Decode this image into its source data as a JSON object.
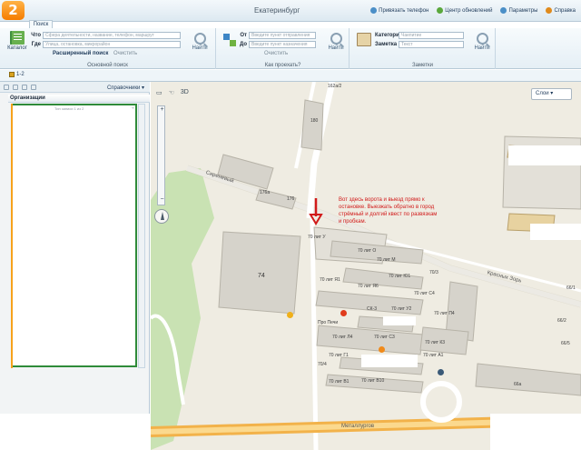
{
  "app": {
    "logo_text": "2",
    "window_title": "Екатеринбург",
    "top_links": [
      "Привязать телефон",
      "Центр обновлений",
      "Параметры",
      "Справка"
    ],
    "tab": "Поиск"
  },
  "ribbon": {
    "catalog_label": "Каталог",
    "what_label": "Что",
    "what_placeholder": "Сфера деятельности, название, телефон, маршрут",
    "where_label": "Где",
    "where_placeholder": "Улица, остановка, микрорайон",
    "advanced_search": "Расширенный поиск",
    "clear": "Очистить",
    "find": "Найти",
    "group_basic": "Основной поиск",
    "from_label": "От",
    "from_placeholder": "Введите пункт отправления",
    "to_label": "До",
    "to_placeholder": "Введите пункт назначения",
    "group_route": "Как проехать?",
    "category_label": "Категория",
    "category_value": "Чаепитие",
    "note_label": "Заметка",
    "note_placeholder": "Текст",
    "group_notes": "Заметки"
  },
  "subbar": {
    "tab_label": "1-2"
  },
  "left_panel": {
    "dropdown": "Справочники",
    "header": "Организации",
    "row_text": "Тип записи 1 из 2",
    "pager": "⇢"
  },
  "map": {
    "mode_3d": "3D",
    "layers": "Слои",
    "annotation": "Вот здесь ворота и выезд прямо к остановке. Выезжать обратно в город стрёмный и долгий квест по развязкам и пробкам.",
    "labels": {
      "street1": "Сиреневый",
      "street2": "Металлургов",
      "street3": "Красных Зорь",
      "b180": "180",
      "b176a": "176а",
      "b176": "176",
      "b74": "74",
      "b162a": "162а/2",
      "prochechi": "Про Печи",
      "l1": "70 лит У",
      "l2": "70 лит О",
      "l3": "70 лит М",
      "l4": "70 лит Ю1",
      "l5": "70 лит Я1",
      "l6": "70 лит Я6",
      "l7": "70 лит Л4",
      "l8": "70 лит С3",
      "l9": "70 лит С4",
      "l10": "70 лит Г1",
      "l11": "70 лит В1",
      "l12": "70 лит В10",
      "l13": "70 лит К3",
      "l14": "70 лит А1",
      "l15": "70 лит П4",
      "l16": "СК-3",
      "l17": "70 лит У2",
      "l18": "70/4",
      "l19": "70/3",
      "l20": "66/1",
      "l21": "66/2",
      "l22": "66/5",
      "l23": "66а"
    }
  },
  "colors": {
    "accent_green": "#2f8b3a",
    "accent_orange": "#f7a21b",
    "annotation_red": "#d11a1a",
    "map_bg": "#efece2",
    "park_green": "#c9e2b3"
  }
}
